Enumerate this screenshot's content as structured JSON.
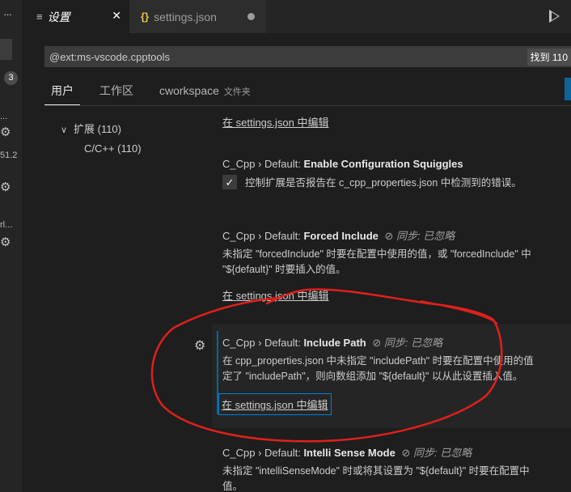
{
  "left_strip": {
    "dots": "···",
    "badge": "3",
    "fragment1": "51.2",
    "fragment2": "rl..."
  },
  "tabs": [
    {
      "label": "设置",
      "icon": "settings-list-icon"
    },
    {
      "label": "settings.json",
      "icon": "json-braces-icon"
    }
  ],
  "search": {
    "value": "@ext:ms-vscode.cpptools",
    "result_count": "找到 110"
  },
  "scope_tabs": {
    "user": "用户",
    "workspace": "工作区",
    "folder": "cworkspace",
    "folder_suffix": "文件夹"
  },
  "toc": {
    "extensions": "扩展 (110)",
    "cpp": "C/C++ (110)"
  },
  "settings": {
    "top_link": "在 settings.json 中编辑",
    "squiggles": {
      "category": "C_Cpp › Default: ",
      "key": "Enable Configuration Squiggles",
      "desc": "控制扩展是否报告在 c_cpp_properties.json 中检测到的错误。",
      "checked": true
    },
    "forced_include": {
      "category": "C_Cpp › Default: ",
      "key": "Forced Include",
      "sync": "同步: 已忽略",
      "desc1": "未指定 \"forcedInclude\" 时要在配置中使用的值，或 \"forcedInclude\" 中",
      "desc2": "\"${default}\" 时要插入的值。",
      "link": "在 settings.json 中编辑"
    },
    "include_path": {
      "category": "C_Cpp › Default: ",
      "key": "Include Path",
      "sync": "同步: 已忽略",
      "desc1": "在 cpp_properties.json 中未指定 \"includePath\" 时要在配置中使用的值",
      "desc2": "定了 \"includePath\"，则向数组添加 \"${default}\" 以从此设置插入值。",
      "link": "在 settings.json 中编辑"
    },
    "intellisense_mode": {
      "category": "C_Cpp › Default: ",
      "key": "Intelli Sense Mode",
      "sync": "同步: 已忽略",
      "desc1": "未指定 \"intelliSenseMode\" 时或将其设置为 \"${default}\" 时要在配置中",
      "desc2": "值。"
    }
  },
  "colors": {
    "annotation": "#e0201b",
    "focus": "#007fd4",
    "background": "#1e1e1e"
  }
}
